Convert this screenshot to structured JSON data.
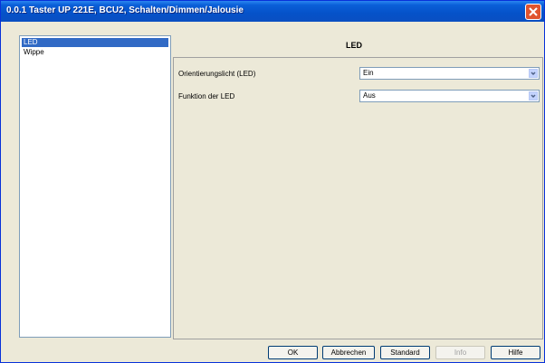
{
  "window": {
    "title": "0.0.1 Taster UP 221E, BCU2, Schalten/Dimmen/Jalousie"
  },
  "tree": {
    "items": [
      {
        "label": "LED",
        "selected": true
      },
      {
        "label": "Wippe",
        "selected": false
      }
    ]
  },
  "panel": {
    "title": "LED",
    "params": [
      {
        "label": "Orientierungslicht (LED)",
        "value": "Ein"
      },
      {
        "label": "Funktion der LED",
        "value": "Aus"
      }
    ]
  },
  "buttons": {
    "ok": "OK",
    "cancel": "Abbrechen",
    "standard": "Standard",
    "info": "Info",
    "help": "Hilfe"
  },
  "colors": {
    "title_bar": "#0552c9",
    "selection": "#316ac5",
    "close": "#e0542e"
  }
}
